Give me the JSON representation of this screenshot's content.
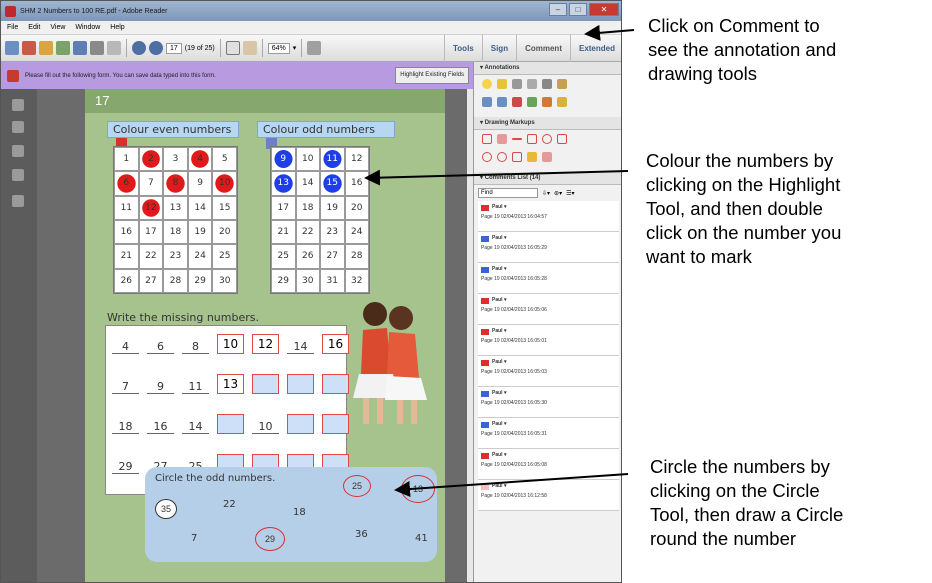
{
  "window": {
    "title": "SHM 2 Numbers to 100 RE.pdf - Adobe Reader"
  },
  "menu": [
    "File",
    "Edit",
    "View",
    "Window",
    "Help"
  ],
  "toolbar": {
    "page_current": "17",
    "page_total": "(19 of 25)",
    "zoom": "64%",
    "links": [
      "Tools",
      "Sign",
      "Comment",
      "Extended"
    ]
  },
  "formbar": {
    "message": "Please fill out the following form. You can save data typed into this form.",
    "highlight_button": "Highlight Existing Fields"
  },
  "page": {
    "number": "17",
    "even_label": "Colour even numbers",
    "odd_label": "Colour odd numbers",
    "even_grid": [
      [
        "1",
        "2",
        "3",
        "4",
        "5"
      ],
      [
        "6",
        "7",
        "8",
        "9",
        "10"
      ],
      [
        "11",
        "12",
        "13",
        "14",
        "15"
      ],
      [
        "16",
        "17",
        "18",
        "19",
        "20"
      ],
      [
        "21",
        "22",
        "23",
        "24",
        "25"
      ],
      [
        "26",
        "27",
        "28",
        "29",
        "30"
      ]
    ],
    "odd_grid": [
      [
        "9",
        "10",
        "11",
        "12"
      ],
      [
        "13",
        "14",
        "15",
        "16"
      ],
      [
        "17",
        "18",
        "19",
        "20"
      ],
      [
        "21",
        "22",
        "23",
        "24"
      ],
      [
        "25",
        "26",
        "27",
        "28"
      ],
      [
        "29",
        "30",
        "31",
        "32"
      ]
    ],
    "missing_title": "Write the missing numbers.",
    "missing_rows": [
      [
        {
          "v": "4"
        },
        {
          "v": "6"
        },
        {
          "v": "8"
        },
        {
          "v": "10",
          "f": 1
        },
        {
          "v": "12",
          "f": 1
        },
        {
          "v": "14"
        },
        {
          "v": "16",
          "f": 1
        }
      ],
      [
        {
          "v": "7"
        },
        {
          "v": "9"
        },
        {
          "v": "11"
        },
        {
          "v": "13",
          "f": 1
        },
        {
          "v": "",
          "f": 1
        },
        {
          "v": "",
          "f": 1
        },
        {
          "v": "",
          "f": 1
        }
      ],
      [
        {
          "v": "18"
        },
        {
          "v": "16"
        },
        {
          "v": "14"
        },
        {
          "v": "",
          "f": 1
        },
        {
          "v": "10"
        },
        {
          "v": "",
          "f": 1
        },
        {
          "v": "",
          "f": 1
        }
      ],
      [
        {
          "v": "29"
        },
        {
          "v": "27"
        },
        {
          "v": "25"
        },
        {
          "v": "",
          "f": 1
        },
        {
          "v": "",
          "f": 1
        },
        {
          "v": "",
          "f": 1
        },
        {
          "v": "",
          "f": 1
        }
      ]
    ],
    "circle_title": "Circle the odd numbers.",
    "circle_numbers": {
      "n35": "35",
      "n22": "22",
      "n25": "25",
      "n13": "13",
      "n18": "18",
      "n7": "7",
      "n29": "29",
      "n36": "36",
      "n41": "41"
    }
  },
  "panel": {
    "annotations": "Annotations",
    "drawing": "Drawing Markups",
    "comments_list": "Comments List (14)",
    "find": "Find",
    "comments": [
      {
        "author": "Paul",
        "meta": "Page 19  02/04/2013 16:04:57",
        "color": "#d9302f"
      },
      {
        "author": "Paul",
        "meta": "Page 19  02/04/2013 16:05:29",
        "color": "#3a63d8"
      },
      {
        "author": "Paul",
        "meta": "Page 19  02/04/2013 16:05:28",
        "color": "#3a63d8"
      },
      {
        "author": "Paul",
        "meta": "Page 19  02/04/2013 16:05:06",
        "color": "#d9302f"
      },
      {
        "author": "Paul",
        "meta": "Page 19  02/04/2013 16:05:01",
        "color": "#d9302f"
      },
      {
        "author": "Paul",
        "meta": "Page 19  02/04/2013 16:05:03",
        "color": "#d9302f"
      },
      {
        "author": "Paul",
        "meta": "Page 19  02/04/2013 16:05:30",
        "color": "#3a63d8"
      },
      {
        "author": "Paul",
        "meta": "Page 19  02/04/2013 16:05:31",
        "color": "#3a63d8"
      },
      {
        "author": "Paul",
        "meta": "Page 19  02/04/2013 16:05:08",
        "color": "#d9302f"
      },
      {
        "author": "Paul",
        "meta": "Page 19  02/04/2013 16:12:58",
        "color": "#f5c0c0"
      }
    ]
  },
  "annotations": [
    "Click on Comment to\nsee the annotation and\ndrawing tools",
    "Colour the numbers by\nclicking on the Highlight\nTool, and then double\nclick on the number you\nwant to mark",
    "Circle the numbers by\nclicking on the Circle\nTool, then draw a Circle\nround the number"
  ]
}
